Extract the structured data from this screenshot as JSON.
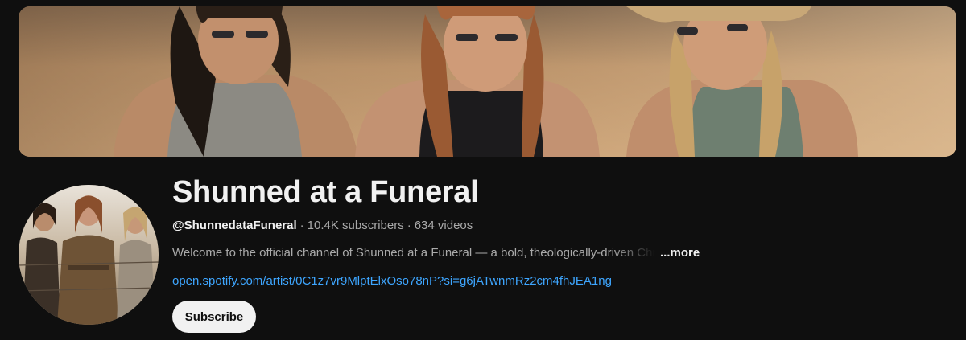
{
  "channel": {
    "name": "Shunned at a Funeral",
    "handle": "@ShunnedataFuneral",
    "separator": "·",
    "subscribers": "10.4K subscribers",
    "videos": "634 videos",
    "description": "Welcome to the official channel of Shunned at a Funeral — a bold, theologically-driven Christian",
    "more_label": "...more",
    "link": "open.spotify.com/artist/0C1z7vr9MlptElxOso78nP?si=g6jATwnmRz2cm4fhJEA1ng"
  },
  "actions": {
    "subscribe_label": "Subscribe"
  },
  "colors": {
    "background": "#0f0f0f",
    "primary_text": "#f1f1f1",
    "secondary_text": "#aaaaaa",
    "link": "#3ea6ff",
    "subscribe_bg": "#f1f1f1"
  }
}
